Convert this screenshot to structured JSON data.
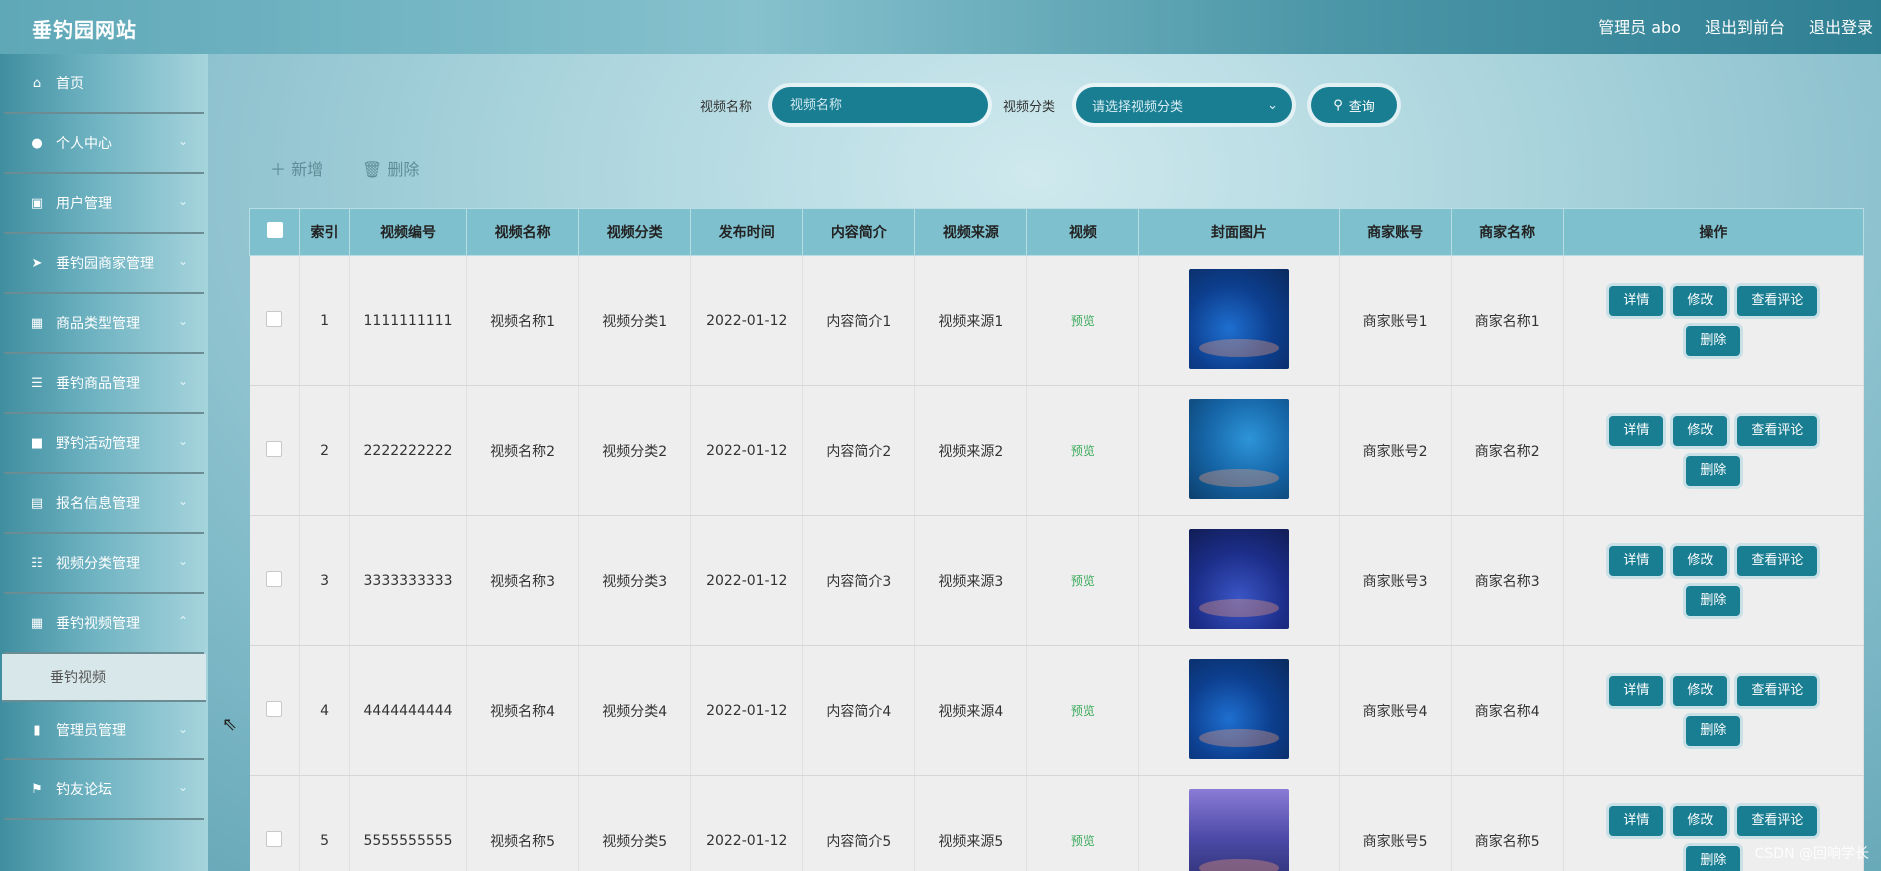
{
  "header": {
    "site_title": "垂钓园网站",
    "user_label": "管理员 abo",
    "to_front": "退出到前台",
    "logout": "退出登录"
  },
  "sidebar": {
    "items": [
      {
        "label": "首页",
        "icon": "home-icon",
        "glyph": "⌂",
        "chevron": false
      },
      {
        "label": "个人中心",
        "icon": "user-icon",
        "glyph": "●",
        "chevron": true
      },
      {
        "label": "用户管理",
        "icon": "checkbox-icon",
        "glyph": "▣",
        "chevron": true
      },
      {
        "label": "垂钓园商家管理",
        "icon": "send-icon",
        "glyph": "➤",
        "chevron": true
      },
      {
        "label": "商品类型管理",
        "icon": "grid-icon",
        "glyph": "▦",
        "chevron": true
      },
      {
        "label": "垂钓商品管理",
        "icon": "list-icon",
        "glyph": "☰",
        "chevron": true
      },
      {
        "label": "野钓活动管理",
        "icon": "briefcase-icon",
        "glyph": "■",
        "chevron": true
      },
      {
        "label": "报名信息管理",
        "icon": "printer-icon",
        "glyph": "▤",
        "chevron": true
      },
      {
        "label": "视频分类管理",
        "icon": "sliders-icon",
        "glyph": "☷",
        "chevron": true
      },
      {
        "label": "垂钓视频管理",
        "icon": "grid-icon",
        "glyph": "▦",
        "chevron": true
      }
    ],
    "sub_item": "垂钓视频",
    "items_after": [
      {
        "label": "管理员管理",
        "icon": "bar-chart-icon",
        "glyph": "▮",
        "chevron": true
      },
      {
        "label": "钓友论坛",
        "icon": "flag-icon",
        "glyph": "⚑",
        "chevron": true
      }
    ]
  },
  "search": {
    "name_label": "视频名称",
    "name_placeholder": "视频名称",
    "category_label": "视频分类",
    "category_placeholder": "请选择视频分类",
    "query_label": "查询"
  },
  "toolbar": {
    "add_label": "新增",
    "delete_label": "删除"
  },
  "table": {
    "headers": [
      "索引",
      "视频编号",
      "视频名称",
      "视频分类",
      "发布时间",
      "内容简介",
      "视频来源",
      "视频",
      "封面图片",
      "商家账号",
      "商家名称",
      "操作"
    ],
    "rows": [
      {
        "index": "1",
        "code": "1111111111",
        "name": "视频名称1",
        "category": "视频分类1",
        "date": "2022-01-12",
        "intro": "内容简介1",
        "source": "视频来源1",
        "video": "预览",
        "account": "商家账号1",
        "merchant": "商家名称1"
      },
      {
        "index": "2",
        "code": "2222222222",
        "name": "视频名称2",
        "category": "视频分类2",
        "date": "2022-01-12",
        "intro": "内容简介2",
        "source": "视频来源2",
        "video": "预览",
        "account": "商家账号2",
        "merchant": "商家名称2"
      },
      {
        "index": "3",
        "code": "3333333333",
        "name": "视频名称3",
        "category": "视频分类3",
        "date": "2022-01-12",
        "intro": "内容简介3",
        "source": "视频来源3",
        "video": "预览",
        "account": "商家账号3",
        "merchant": "商家名称3"
      },
      {
        "index": "4",
        "code": "4444444444",
        "name": "视频名称4",
        "category": "视频分类4",
        "date": "2022-01-12",
        "intro": "内容简介4",
        "source": "视频来源4",
        "video": "预览",
        "account": "商家账号4",
        "merchant": "商家名称4"
      },
      {
        "index": "5",
        "code": "5555555555",
        "name": "视频名称5",
        "category": "视频分类5",
        "date": "2022-01-12",
        "intro": "内容简介5",
        "source": "视频来源5",
        "video": "预览",
        "account": "商家账号5",
        "merchant": "商家名称5"
      }
    ],
    "actions": {
      "detail": "详情",
      "edit": "修改",
      "comments": "查看评论",
      "delete": "删除"
    }
  },
  "watermark": "CSDN @回响学长",
  "colors": {
    "accent": "#1a7e93",
    "table_header": "#7fc0ce",
    "preview_link": "#3aaa5a"
  }
}
